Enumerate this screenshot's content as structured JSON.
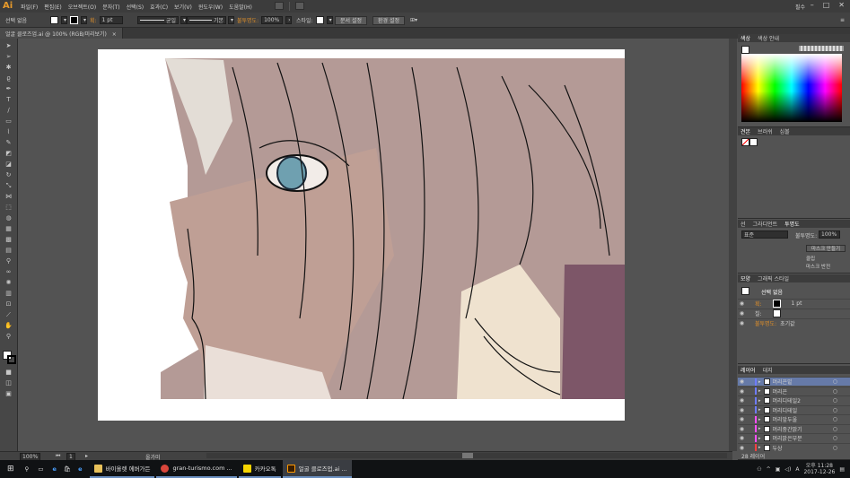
{
  "app": {
    "logo": "Ai",
    "user": "필수",
    "menus": [
      "파일(F)",
      "편집(E)",
      "오브젝트(O)",
      "문자(T)",
      "선택(S)",
      "효과(C)",
      "보기(V)",
      "윈도우(W)",
      "도움말(H)"
    ]
  },
  "options": {
    "selection": "선택 없음",
    "stroke_label": "획:",
    "stroke_value": "1 pt",
    "brush1": "균일",
    "brush2": "기본",
    "opacity_label": "불투명도:",
    "opacity_value": "100%",
    "style_label": "스타일:",
    "doc_setup": "문서 설정",
    "prefs": "환경 설정"
  },
  "doc_tab": {
    "title": "얼굴 클로즈업.ai @ 100% (RGB/미리보기)",
    "close": "×"
  },
  "status": {
    "zoom": "100%",
    "page": "1",
    "tool": "올가미"
  },
  "panels": {
    "color": {
      "tabs": [
        "색상",
        "색상 안내"
      ]
    },
    "swatches": {
      "tabs": [
        "견본",
        "브러쉬",
        "심볼"
      ]
    },
    "transparency": {
      "tabs": [
        "선",
        "그라디언트",
        "투명도"
      ],
      "blend": "표준",
      "opacity_label": "불투명도:",
      "opacity_value": "100%",
      "make_mask": "마스크 만들기",
      "clip": "클립",
      "invert": "마스크 반전"
    },
    "appearance": {
      "tabs": [
        "모양",
        "그래픽 스타일"
      ],
      "title": "선택 없음",
      "stroke_label": "획:",
      "stroke_value": "1 pt",
      "fill_label": "칠:",
      "opacity_label": "불투명도:",
      "opacity_value": "초기값"
    },
    "layers": {
      "tabs": [
        "레이어",
        "대지"
      ],
      "footer": "28 레이어",
      "items": [
        {
          "name": "머리끈밑",
          "color": "#6e7cff"
        },
        {
          "name": "머리끈",
          "color": "#6e7cff"
        },
        {
          "name": "머리디테일2",
          "color": "#6e7cff"
        },
        {
          "name": "머리디테일",
          "color": "#6e7cff"
        },
        {
          "name": "머리앞두울",
          "color": "#ff4fff"
        },
        {
          "name": "머리중간밝기",
          "color": "#ff4fff"
        },
        {
          "name": "머리밝은부분",
          "color": "#ff4fff"
        },
        {
          "name": "두상",
          "color": "#ff4040"
        }
      ]
    }
  },
  "taskbar": {
    "apps": [
      "바이올렛 에버가든",
      "gran-turismo.com ...",
      "카카오톡",
      "얼굴 클로즈업.ai ..."
    ],
    "time": "오후 11:28",
    "date": "2017-12-26",
    "ime": "A"
  }
}
